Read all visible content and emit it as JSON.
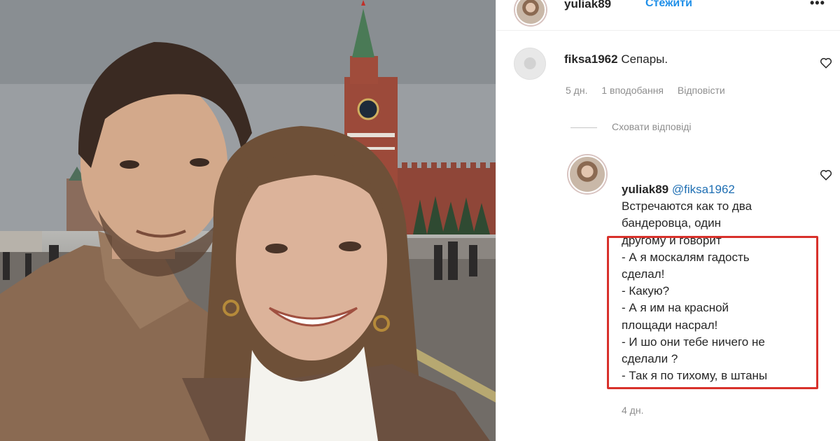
{
  "post": {
    "author": "yuliak89",
    "follow_label": "Стежити",
    "more_label": "•••"
  },
  "comments": [
    {
      "user": "fiksa1962",
      "text": "Сепары.",
      "time": "5 дн.",
      "likes": "1 вподобання",
      "reply_label": "Відповісти",
      "hide_replies_label": "Сховати відповіді"
    }
  ],
  "reply": {
    "user": "yuliak89",
    "mention": "@fiksa1962",
    "lines": [
      "Встречаются как то два",
      "бандеровца, один",
      "другому и говорит",
      "- А я москалям гадость",
      "сделал!",
      "- Какую?",
      "- А я им на красной",
      "площади насрал!",
      "- И шо они тебе ничего не",
      "сделали ?",
      "- Так я по тихому, в штаны"
    ],
    "time": "4 дн."
  },
  "colors": {
    "accent": "#1f8fe8",
    "highlight": "#d8312b",
    "muted": "#8e8e8e"
  }
}
